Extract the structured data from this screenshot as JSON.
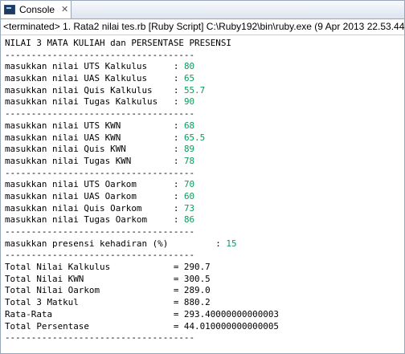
{
  "tab": {
    "label": "Console",
    "close": "✕",
    "icon": "console-icon"
  },
  "status": "<terminated> 1. Rata2 nilai tes.rb [Ruby Script] C:\\Ruby192\\bin\\ruby.exe (9 Apr 2013 22.53.44)",
  "colors": {
    "input": "#0b9b5a"
  },
  "lines": [
    {
      "t": "NILAI 3 MATA KULIAH dan PERSENTASE PRESENSI"
    },
    {
      "t": "------------------------------------"
    },
    {
      "t": "masukkan nilai UTS Kalkulus     : ",
      "v": "80"
    },
    {
      "t": "masukkan nilai UAS Kalkulus     : ",
      "v": "65"
    },
    {
      "t": "masukkan nilai Quis Kalkulus    : ",
      "v": "55.7"
    },
    {
      "t": "masukkan nilai Tugas Kalkulus   : ",
      "v": "90"
    },
    {
      "t": "------------------------------------"
    },
    {
      "t": "masukkan nilai UTS KWN          : ",
      "v": "68"
    },
    {
      "t": "masukkan nilai UAS KWN          : ",
      "v": "65.5"
    },
    {
      "t": "masukkan nilai Quis KWN         : ",
      "v": "89"
    },
    {
      "t": "masukkan nilai Tugas KWN        : ",
      "v": "78"
    },
    {
      "t": "------------------------------------"
    },
    {
      "t": "masukkan nilai UTS Oarkom       : ",
      "v": "70"
    },
    {
      "t": "masukkan nilai UAS Oarkom       : ",
      "v": "60"
    },
    {
      "t": "masukkan nilai Quis Oarkom      : ",
      "v": "73"
    },
    {
      "t": "masukkan nilai Tugas Oarkom     : ",
      "v": "86"
    },
    {
      "t": "------------------------------------"
    },
    {
      "t": "masukkan presensi kehadiran (%)         : ",
      "v": "15"
    },
    {
      "t": "------------------------------------"
    },
    {
      "t": "Total Nilai Kalkulus            = 290.7"
    },
    {
      "t": "Total Nilai KWN                 = 300.5"
    },
    {
      "t": "Total Nilai Oarkom              = 289.0"
    },
    {
      "t": "Total 3 Matkul                  = 880.2"
    },
    {
      "t": "Rata-Rata                       = 293.40000000000003"
    },
    {
      "t": "Total Persentase                = 44.010000000000005"
    },
    {
      "t": "------------------------------------"
    }
  ]
}
